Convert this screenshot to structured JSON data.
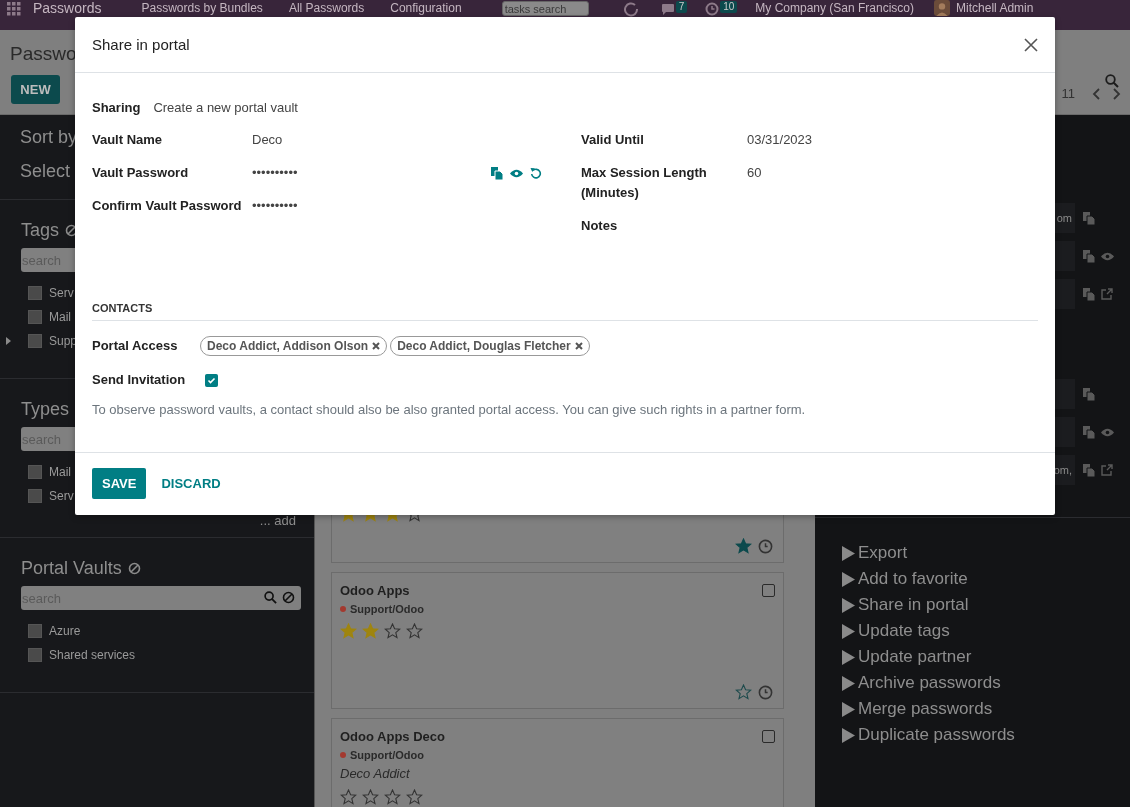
{
  "navbar": {
    "app_name": "Passwords",
    "menu": [
      "Passwords by Bundles",
      "All Passwords",
      "Configuration"
    ],
    "search": {
      "placeholder": "tasks search"
    },
    "messages_count": "7",
    "activities_count": "10",
    "company": "My Company (San Francisco)",
    "user": "Mitchell Admin"
  },
  "control_panel": {
    "breadcrumb": "Passwo",
    "new_button": "NEW",
    "pager": "11"
  },
  "sidebar": {
    "sort_by": "Sort by",
    "select": "Select",
    "sections": [
      {
        "title": "Tags",
        "clear_icon": true,
        "search": {
          "placeholder": "search"
        },
        "items": [
          {
            "label": "Serv",
            "checked": false,
            "expandable": false
          },
          {
            "label": "Mail",
            "checked": false,
            "expandable": false
          },
          {
            "label": "Supp",
            "checked": false,
            "expandable": true
          }
        ]
      },
      {
        "title": "Types",
        "search": {
          "placeholder": "search"
        },
        "items": [
          {
            "label": "Mail",
            "checked": false,
            "expandable": false
          },
          {
            "label": "Serv",
            "checked": false,
            "expandable": false
          }
        ],
        "add_link": "... add"
      },
      {
        "title": "Portal Vaults",
        "clear_icon": true,
        "search": {
          "placeholder": "search"
        },
        "search_buttons": true,
        "items": [
          {
            "label": "Azure",
            "checked": false,
            "expandable": false
          },
          {
            "label": "Shared services",
            "checked": false,
            "expandable": false
          }
        ]
      }
    ]
  },
  "kanban": {
    "cards": [
      {
        "stars": 3,
        "favorite": true
      },
      {
        "title": "Odoo Apps",
        "tag": {
          "label": "Support/Odoo",
          "color": "#a3392f"
        },
        "stars": 2,
        "favorite": false,
        "checked": false
      },
      {
        "title": "Odoo Apps Deco",
        "tag": {
          "label": "Support/Odoo",
          "color": "#a3392f"
        },
        "partner": "Deco Addict",
        "stars": 0,
        "checked": false
      }
    ]
  },
  "side_panel": {
    "field_groups": [
      {
        "fields": [
          {
            "kind": "text",
            "value": "om"
          },
          {
            "kind": "secret"
          },
          {
            "kind": "url"
          }
        ]
      },
      {
        "fields": [
          {
            "kind": "text"
          },
          {
            "kind": "secret"
          },
          {
            "kind": "url",
            "value": "om,"
          }
        ]
      }
    ],
    "actions": [
      "Export",
      "Add to favorite",
      "Share in portal",
      "Update tags",
      "Update partner",
      "Archive passwords",
      "Merge passwords",
      "Duplicate passwords"
    ]
  },
  "dialog": {
    "title": "Share in portal",
    "sharing": {
      "label": "Sharing",
      "value": "Create a new portal vault"
    },
    "left_fields": [
      {
        "kind": "text",
        "label": "Vault Name",
        "value": "Deco"
      },
      {
        "kind": "password",
        "label": "Vault Password",
        "value": "••••••••••"
      },
      {
        "kind": "text",
        "label": "Confirm Vault Password",
        "value": "••••••••••"
      }
    ],
    "right_fields": [
      {
        "label": "Valid Until",
        "value": "03/31/2023"
      },
      {
        "label": "Max Session Length (Minutes)",
        "value": "60"
      },
      {
        "label": "Notes"
      }
    ],
    "contacts": {
      "heading": "CONTACTS",
      "portal_access": {
        "label": "Portal Access",
        "tags": [
          "Deco Addict, Addison Olson",
          "Deco Addict, Douglas Fletcher"
        ]
      },
      "send_invitation": {
        "label": "Send Invitation",
        "checked": true
      },
      "help": "To observe password vaults, a contact should also be also granted portal access. You can give such rights in a partner form."
    },
    "buttons": [
      {
        "label": "SAVE",
        "kind": "primary"
      },
      {
        "label": "DISCARD",
        "kind": "secondary"
      }
    ]
  }
}
